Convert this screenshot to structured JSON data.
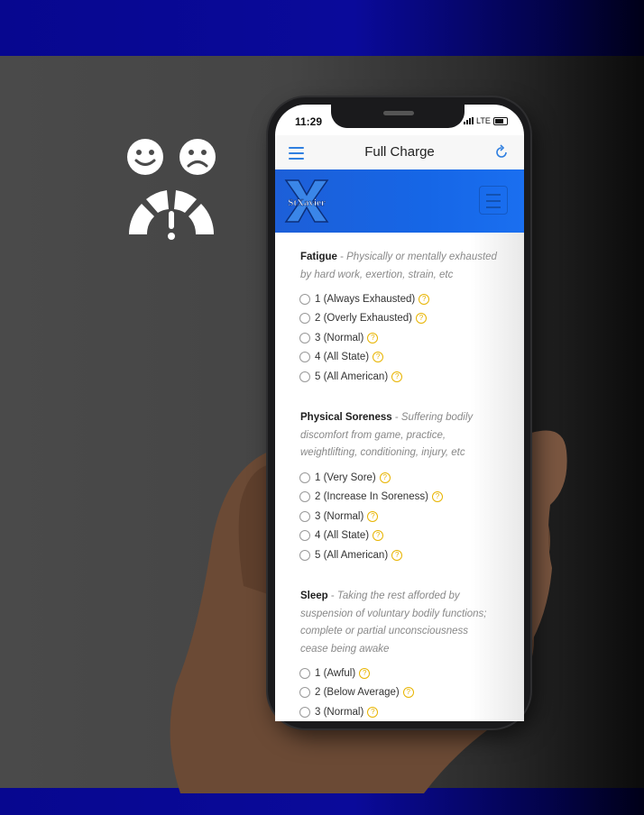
{
  "status": {
    "time": "11:29",
    "network": "LTE"
  },
  "app": {
    "title": "Full Charge"
  },
  "brand": {
    "name": "St. Xavier",
    "letter": "X"
  },
  "questions": [
    {
      "title": "Fatigue",
      "description": "Physically or mentally exhausted by hard work, exertion, strain, etc",
      "options": [
        "1 (Always Exhausted)",
        "2 (Overly Exhausted)",
        "3 (Normal)",
        "4 (All State)",
        "5 (All American)"
      ]
    },
    {
      "title": "Physical Soreness",
      "description": "Suffering bodily discomfort from game, practice, weightlifting, conditioning, injury, etc",
      "options": [
        "1 (Very Sore)",
        "2 (Increase In Soreness)",
        "3 (Normal)",
        "4 (All State)",
        "5 (All American)"
      ]
    },
    {
      "title": "Sleep",
      "description": "Taking the rest afforded by suspension of voluntary bodily functions; complete or partial unconsciousness cease being awake",
      "options": [
        "1 (Awful)",
        "2 (Below Average)",
        "3 (Normal)"
      ]
    }
  ],
  "colors": {
    "band": "#0a0a9a",
    "brand_bar": "#1666e6",
    "accent": "#2f7fe0",
    "help": "#e8b400"
  },
  "icons": {
    "menu": "hamburger-icon",
    "refresh": "refresh-icon",
    "help": "question-circle-icon",
    "logo": "mood-gauge-logo"
  }
}
